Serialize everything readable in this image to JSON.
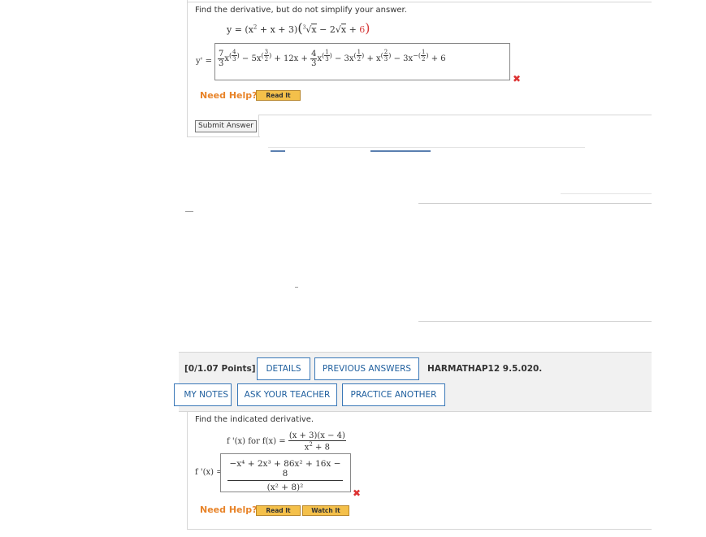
{
  "q1": {
    "instruction": "Find the derivative, but do not simplify your answer.",
    "equation": {
      "lhs": "y = (x",
      "sq": "2",
      "mid": " + x + 3)",
      "paren_open": "(",
      "cube_root_index": "3",
      "cube_root_arg": "x",
      "minus": " − 2",
      "sqrt_arg": "x",
      "plus": " + ",
      "six": "6",
      "paren_close": ")"
    },
    "answer_label": "y' =",
    "answer_terms": {
      "t1_num": "7",
      "t1_den": "3",
      "t1_var": "x",
      "t1_exp_num": "4",
      "t1_exp_den": "3",
      "t2": "− 5x",
      "t2_exp_num": "3",
      "t2_exp_den": "2",
      "t3": "+ 12x +",
      "t4_num": "4",
      "t4_den": "3",
      "t4_var": "x",
      "t4_exp_num": "1",
      "t4_exp_den": "3",
      "t5": "− 3x",
      "t5_exp_num": "1",
      "t5_exp_den": "2",
      "t6": "+ x",
      "t6_exp_num": "2",
      "t6_exp_den": "3",
      "t7": "− 3x",
      "t7_exp_prefix": "−",
      "t7_exp_num": "1",
      "t7_exp_den": "2",
      "t8": "+ 6"
    },
    "incorrect_mark": "✖",
    "need_help": "Need Help?",
    "read_it": "Read It",
    "submit": "Submit Answer"
  },
  "q2": {
    "points": "[0/1.07 Points]",
    "tabs": {
      "details": "DETAILS",
      "previous_answers": "PREVIOUS ANSWERS",
      "my_notes": "MY NOTES",
      "ask_teacher": "ASK YOUR TEACHER",
      "practice_another": "PRACTICE ANOTHER"
    },
    "problem_code": "HARMATHAP12 9.5.020.",
    "instruction": "Find the indicated derivative.",
    "prompt_prefix": "f '(x) for f(x) =",
    "prompt_num": "(x + 3)(x − 4)",
    "prompt_den_base": "x",
    "prompt_den_exp": "2",
    "prompt_den_rest": " + 8",
    "answer_label": "f '(x) =",
    "answer_num": "−x⁴ + 2x³ + 86x² + 16x − 8",
    "answer_den": "(x² + 8)²",
    "incorrect_mark": "✖",
    "need_help": "Need Help?",
    "read_it": "Read It",
    "watch_it": "Watch It"
  }
}
